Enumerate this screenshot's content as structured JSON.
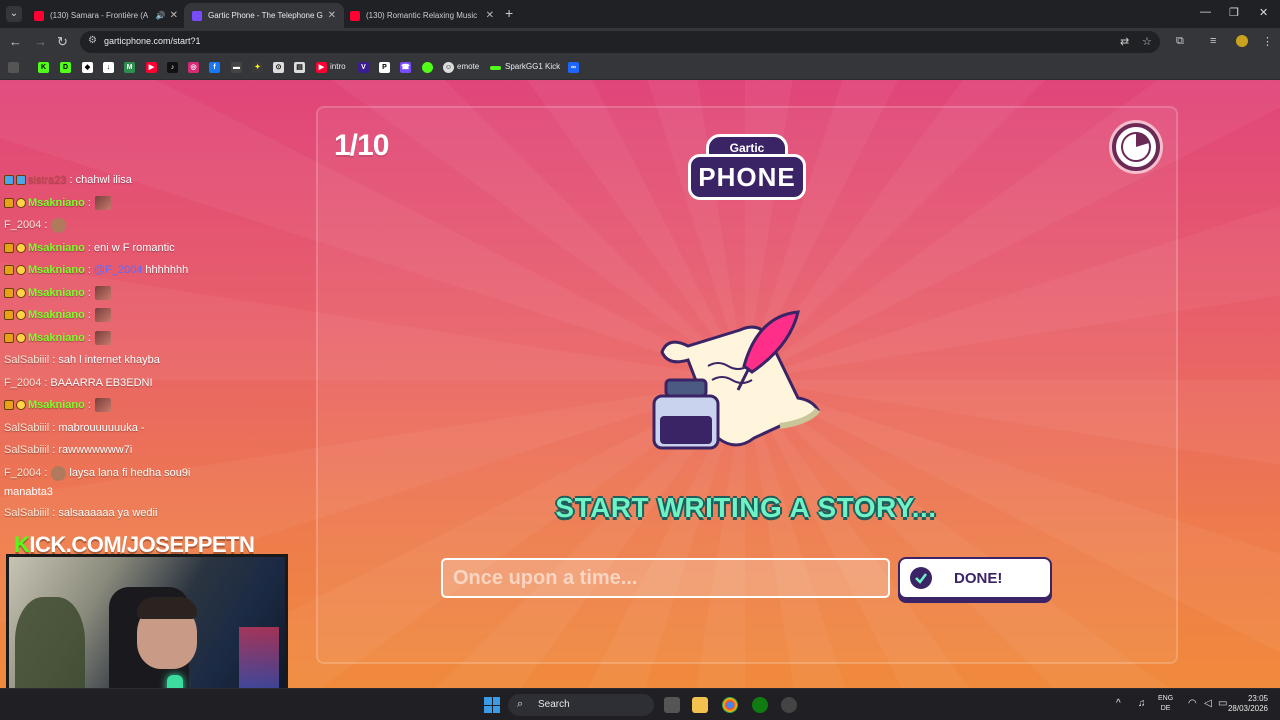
{
  "browser": {
    "tabs": [
      {
        "title": "(130) Samara - Frontière (A",
        "favicon_color": "#ff0033"
      },
      {
        "title": "Gartic Phone - The Telephone G",
        "favicon_color": "#7a4cff"
      },
      {
        "title": "(130) Romantic Relaxing Music",
        "favicon_color": "#ff0033"
      }
    ],
    "url": "garticphone.com/start?1",
    "bookmarks": [
      "intro",
      "emote",
      "SparkGG1 Kick"
    ]
  },
  "game": {
    "round": "1/10",
    "logo_top": "Gartic",
    "logo_main": "PHONE",
    "prompt": "START WRITING A STORY...",
    "input_placeholder": "Once upon a time...",
    "done_label": "DONE!",
    "accent_color": "#6ef3c6",
    "brand_color": "#3b2466"
  },
  "stream": {
    "chat": [
      {
        "user": "sistra23",
        "text": ": chahwl ilisa"
      },
      {
        "user": "Msakniano",
        "text": ":"
      },
      {
        "user": "F_2004",
        "text": ":"
      },
      {
        "user": "Msakniano",
        "text": ": eni w F romantic"
      },
      {
        "user": "Msakniano",
        "text": ":",
        "mention": "@F_2004",
        "after": "hhhhhhh"
      },
      {
        "user": "Msakniano",
        "text": ":"
      },
      {
        "user": "Msakniano",
        "text": ":"
      },
      {
        "user": "Msakniano",
        "text": ":"
      },
      {
        "user": "SalSabiiil",
        "text": ": sah l internet khayba"
      },
      {
        "user": "F_2004",
        "text": ": BAAARRA EB3EDNI"
      },
      {
        "user": "Msakniano",
        "text": ":"
      },
      {
        "user": "SalSabiiil",
        "text": ": mabrouuuuuuka -"
      },
      {
        "user": "SalSabiiil",
        "text": ": rawwwwwww7i"
      },
      {
        "user": "F_2004",
        "text": ":",
        "after": "laysa lana fi hedha sou9i"
      },
      {
        "user": "",
        "text": "manabta3"
      },
      {
        "user": "SalSabiiil",
        "text": ": salsaaaaaa ya wedii"
      }
    ],
    "kick_prefix": "K",
    "kick_rest": "ICK.COM/JOSEPPETN"
  },
  "taskbar": {
    "search_label": "Search",
    "lang_top": "ENG",
    "lang_bottom": "DE",
    "time": "23:05",
    "date": "28/03/2026"
  }
}
